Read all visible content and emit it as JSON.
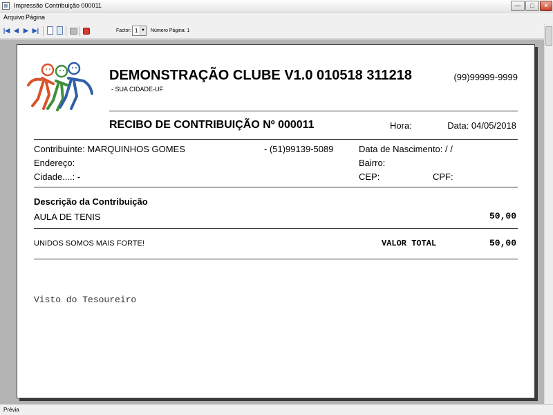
{
  "window": {
    "title": "Impressão Contribuição 000011",
    "minimize": "—",
    "maximize": "□",
    "close": "×"
  },
  "menu": {
    "items": [
      "Arquivo",
      "Página"
    ]
  },
  "toolbar": {
    "buttons": [
      "first-page-icon",
      "previous-page-icon",
      "next-page-icon",
      "last-page-icon",
      "page-icon",
      "two-pages-icon",
      "print-icon",
      "stop-icon"
    ],
    "first_glyph": "|◀",
    "prev_glyph": "◀",
    "next_glyph": "▶",
    "last_glyph": "▶|",
    "factor_label": "Factor:",
    "factor_value": "1",
    "factor_arrow": "▼",
    "page_label": "Número Página: 1"
  },
  "receipt": {
    "club_name": "DEMONSTRAÇÃO CLUBE V1.0 010518 311218",
    "phone": "(99)99999-9999",
    "city": "- SUA CIDADE-UF",
    "title": "RECIBO DE CONTRIBUIÇÃO Nº 000011",
    "hora": "Hora:",
    "data": "Data: 04/05/2018",
    "contribuinte": "Contribuinte: MARQUINHOS GOMES",
    "telefone": "- (51)99139-5089",
    "nascimento": "Data de Nascimento:  /  /",
    "endereco": "Endereço:",
    "bairro": "Bairro:",
    "cidade": "Cidade....: -",
    "cep": "CEP:",
    "cpf": "CPF:",
    "descricao_title": "Descrição da Contribuição",
    "item_desc": "AULA DE TENIS",
    "item_value": "50,00",
    "slogan": "UNIDOS SOMOS MAIS FORTE!",
    "total_label": "VALOR TOTAL",
    "total_value": "50,00",
    "visto": "Visto do Tesoureiro"
  },
  "status": {
    "text": "Prévia"
  },
  "colors": {
    "logo_red": "#d9532a",
    "logo_green": "#3f8f3a",
    "logo_blue": "#2f5fa8",
    "toolbar_blue": "#2a58b5"
  }
}
